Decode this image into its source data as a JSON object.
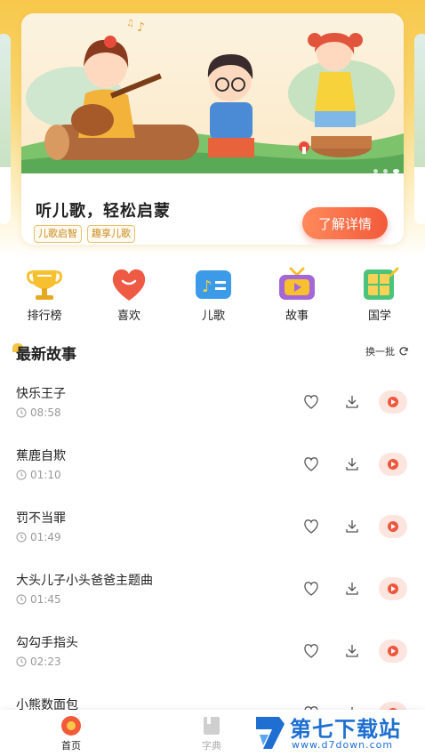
{
  "banner": {
    "title": "听儿歌，轻松启蒙",
    "tags": [
      "儿歌启智",
      "趣享儿歌"
    ],
    "cta_label": "了解详情"
  },
  "categories": [
    {
      "label": "排行榜",
      "icon": "trophy-icon"
    },
    {
      "label": "喜欢",
      "icon": "heart-icon"
    },
    {
      "label": "儿歌",
      "icon": "music-note-icon"
    },
    {
      "label": "故事",
      "icon": "tv-icon"
    },
    {
      "label": "国学",
      "icon": "book-icon"
    }
  ],
  "section": {
    "title": "最新故事",
    "refresh_label": "换一批"
  },
  "stories": [
    {
      "name": "快乐王子",
      "duration": "08:58"
    },
    {
      "name": "蕉鹿自欺",
      "duration": "01:10"
    },
    {
      "name": "罚不当罪",
      "duration": "01:49"
    },
    {
      "name": "大头儿子小头爸爸主题曲",
      "duration": "01:45"
    },
    {
      "name": "勾勾手指头",
      "duration": "02:23"
    },
    {
      "name": "小熊数面包",
      "duration": ""
    }
  ],
  "nav": {
    "home_label": "首页",
    "dict_label": "字典"
  },
  "watermark": {
    "brand": "第七下载站",
    "url": "www.d7down.com"
  },
  "colors": {
    "accent": "#f25a3a",
    "brand_yellow": "#f7c84a",
    "watermark_blue": "#1e6fd1"
  }
}
